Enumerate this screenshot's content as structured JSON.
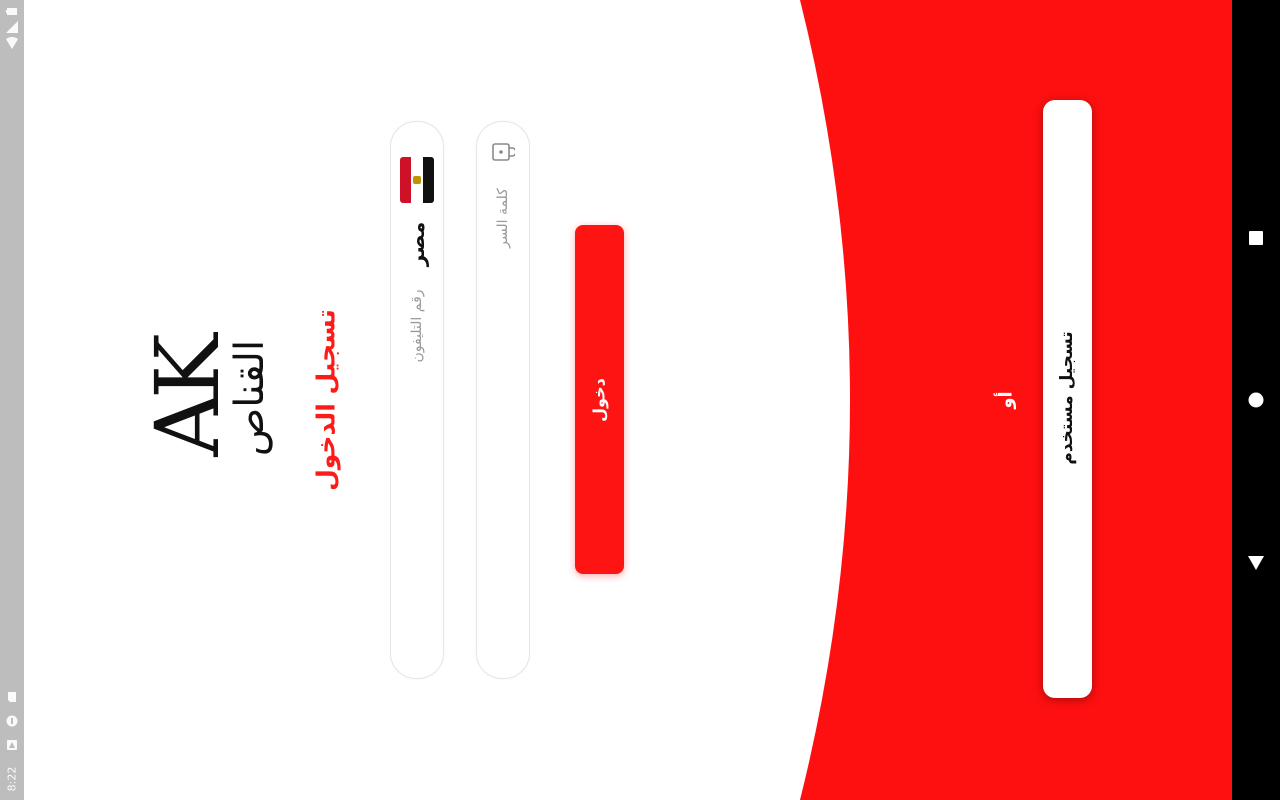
{
  "status_bar": {
    "time": "8:22",
    "icons": [
      "battery-icon",
      "signal-icon",
      "wifi-icon",
      "sd-card-icon",
      "sync-icon",
      "notification-icon"
    ]
  },
  "nav_bar": {
    "icons": [
      "recents-icon",
      "home-icon",
      "back-icon"
    ]
  },
  "colors": {
    "accent": "#ff1414",
    "title": "#ff1a1a"
  },
  "logo": {
    "mark": "AK",
    "name": "القناص"
  },
  "login": {
    "title": "تسجيل الدخول",
    "country_name": "مصر",
    "phone_placeholder": "رقم التليفون",
    "password_placeholder": "كلمة السر",
    "submit_label": "دخول"
  },
  "footer": {
    "or_label": "أو",
    "register_label": "تسجيل مستخدم"
  }
}
